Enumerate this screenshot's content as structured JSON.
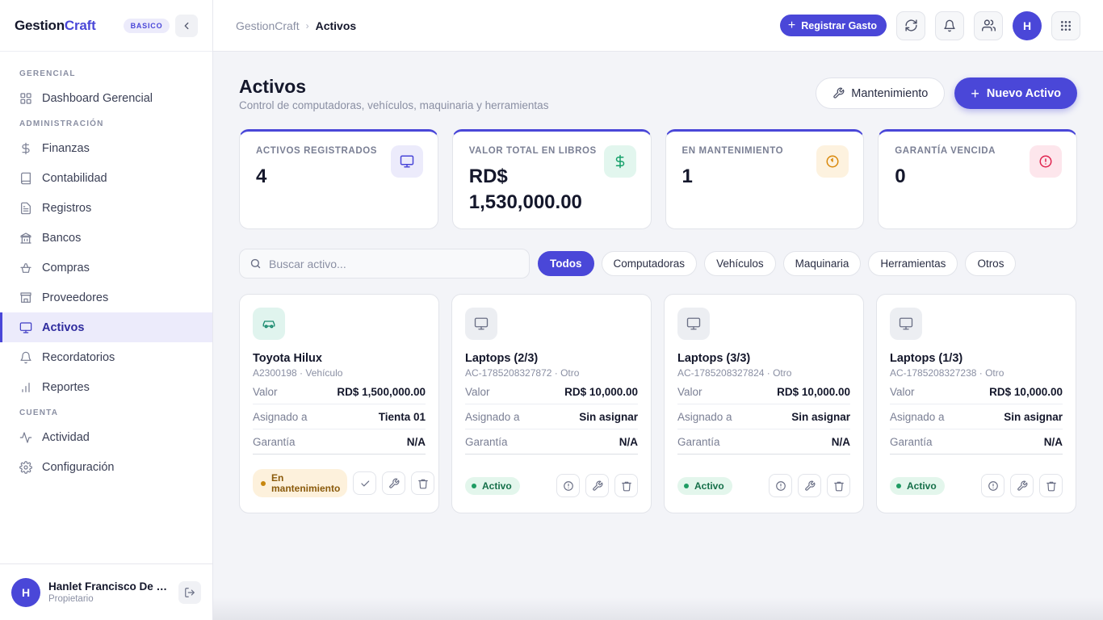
{
  "app": {
    "brand_main": "Gestion",
    "brand_accent": "Craft",
    "plan": "BASICO",
    "accent_color": "#4a47d8"
  },
  "sidebar": {
    "sections": [
      {
        "label": "GERENCIAL",
        "items": [
          {
            "label": "Dashboard Gerencial",
            "icon": "grid-icon"
          }
        ]
      },
      {
        "label": "ADMINISTRACIÓN",
        "items": [
          {
            "label": "Finanzas",
            "icon": "dollar-icon"
          },
          {
            "label": "Contabilidad",
            "icon": "book-icon"
          },
          {
            "label": "Registros",
            "icon": "document-icon"
          },
          {
            "label": "Bancos",
            "icon": "bank-icon"
          },
          {
            "label": "Compras",
            "icon": "shopping-basket-icon"
          },
          {
            "label": "Proveedores",
            "icon": "store-icon"
          },
          {
            "label": "Activos",
            "icon": "monitor-icon",
            "active": true
          },
          {
            "label": "Recordatorios",
            "icon": "bell-icon"
          },
          {
            "label": "Reportes",
            "icon": "bar-chart-icon"
          }
        ]
      },
      {
        "label": "CUENTA",
        "items": [
          {
            "label": "Actividad",
            "icon": "activity-icon"
          },
          {
            "label": "Configuración",
            "icon": "settings-icon"
          }
        ]
      }
    ],
    "user": {
      "initial": "H",
      "name": "Hanlet Francisco De L...",
      "role": "Propietario"
    }
  },
  "topbar": {
    "breadcrumb_root": "GestionCraft",
    "breadcrumb_current": "Activos",
    "register_expense_label": "Registrar Gasto",
    "avatar_initial": "H"
  },
  "page": {
    "title": "Activos",
    "subtitle": "Control de computadoras, vehículos, maquinaria y herramientas",
    "maintenance_button": "Mantenimiento",
    "new_asset_button": "Nuevo Activo"
  },
  "stats": [
    {
      "label": "ACTIVOS REGISTRADOS",
      "value": "4",
      "icon": "monitor-icon",
      "icon_color": "#4a47d8",
      "icon_bg": "#ecebfb"
    },
    {
      "label": "VALOR TOTAL EN LIBROS",
      "value": "RD$ 1,530,000.00",
      "icon": "dollar-icon",
      "icon_color": "#16a06a",
      "icon_bg": "#e2f6ee"
    },
    {
      "label": "EN MANTENIMIENTO",
      "value": "1",
      "icon": "clock-icon",
      "icon_color": "#d9890c",
      "icon_bg": "#fdf2df"
    },
    {
      "label": "GARANTÍA VENCIDA",
      "value": "0",
      "icon": "alert-circle-icon",
      "icon_color": "#e0244f",
      "icon_bg": "#fde6ec"
    }
  ],
  "search": {
    "placeholder": "Buscar activo...",
    "value": ""
  },
  "filters": [
    {
      "label": "Todos",
      "active": true
    },
    {
      "label": "Computadoras"
    },
    {
      "label": "Vehículos"
    },
    {
      "label": "Maquinaria"
    },
    {
      "label": "Herramientas"
    },
    {
      "label": "Otros"
    }
  ],
  "assets": [
    {
      "name": "Toyota Hilux",
      "code": "A2300198 · Vehículo",
      "icon": "car-icon",
      "icon_color": "#1a8a6f",
      "icon_bg": "#e0f4ee",
      "rows": [
        {
          "k": "Valor",
          "v": "RD$ 1,500,000.00"
        },
        {
          "k": "Asignado a",
          "v": "Tienta 01"
        },
        {
          "k": "Garantía",
          "v": "N/A"
        }
      ],
      "status": "En mantenimiento",
      "status_kind": "maintenance"
    },
    {
      "name": "Laptops (2/3)",
      "code": "AC-1785208327872 · Otro",
      "icon": "monitor-icon",
      "icon_color": "#6a6f85",
      "icon_bg": "#eceef2",
      "rows": [
        {
          "k": "Valor",
          "v": "RD$ 10,000.00"
        },
        {
          "k": "Asignado a",
          "v": "Sin asignar"
        },
        {
          "k": "Garantía",
          "v": "N/A"
        }
      ],
      "status": "Activo",
      "status_kind": "active"
    },
    {
      "name": "Laptops (3/3)",
      "code": "AC-1785208327824 · Otro",
      "icon": "monitor-icon",
      "icon_color": "#6a6f85",
      "icon_bg": "#eceef2",
      "rows": [
        {
          "k": "Valor",
          "v": "RD$ 10,000.00"
        },
        {
          "k": "Asignado a",
          "v": "Sin asignar"
        },
        {
          "k": "Garantía",
          "v": "N/A"
        }
      ],
      "status": "Activo",
      "status_kind": "active"
    },
    {
      "name": "Laptops (1/3)",
      "code": "AC-1785208327238 · Otro",
      "icon": "monitor-icon",
      "icon_color": "#6a6f85",
      "icon_bg": "#eceef2",
      "rows": [
        {
          "k": "Valor",
          "v": "RD$ 10,000.00"
        },
        {
          "k": "Asignado a",
          "v": "Sin asignar"
        },
        {
          "k": "Garantía",
          "v": "N/A"
        }
      ],
      "status": "Activo",
      "status_kind": "active"
    }
  ]
}
